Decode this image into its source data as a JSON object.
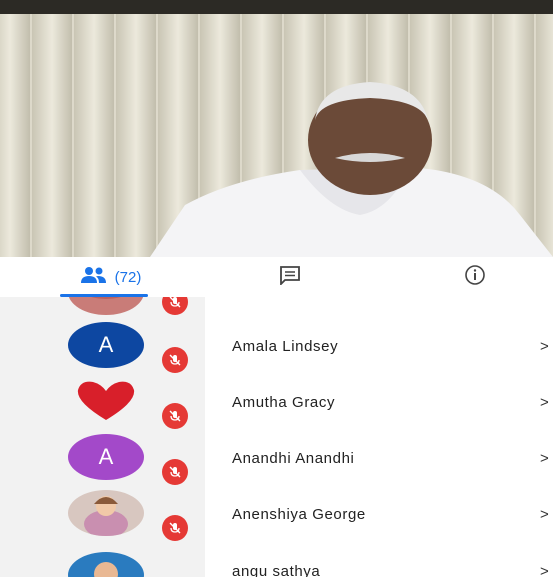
{
  "tabs": {
    "participants": {
      "count_label": "(72)",
      "icon": "people-icon",
      "accent": "#1a73e8"
    },
    "chat": {
      "icon": "chat-icon"
    },
    "info": {
      "icon": "info-icon"
    }
  },
  "participants": [
    {
      "name": "",
      "avatar": "photo",
      "muted": true
    },
    {
      "name": "Amala Lindsey",
      "avatar": "letter",
      "letter": "A",
      "color": "#0d47a1",
      "muted": true
    },
    {
      "name": "Amutha Gracy",
      "avatar": "heart-image",
      "muted": true
    },
    {
      "name": "Anandhi Anandhi",
      "avatar": "letter",
      "letter": "A",
      "color": "#a349c9",
      "muted": true
    },
    {
      "name": "Anenshiya George",
      "avatar": "photo",
      "muted": true
    },
    {
      "name": "angu sathya",
      "avatar": "photo",
      "muted": true
    }
  ],
  "chevron": ">",
  "colors": {
    "mute": "#e53935",
    "strip": "#f2f2f2"
  }
}
